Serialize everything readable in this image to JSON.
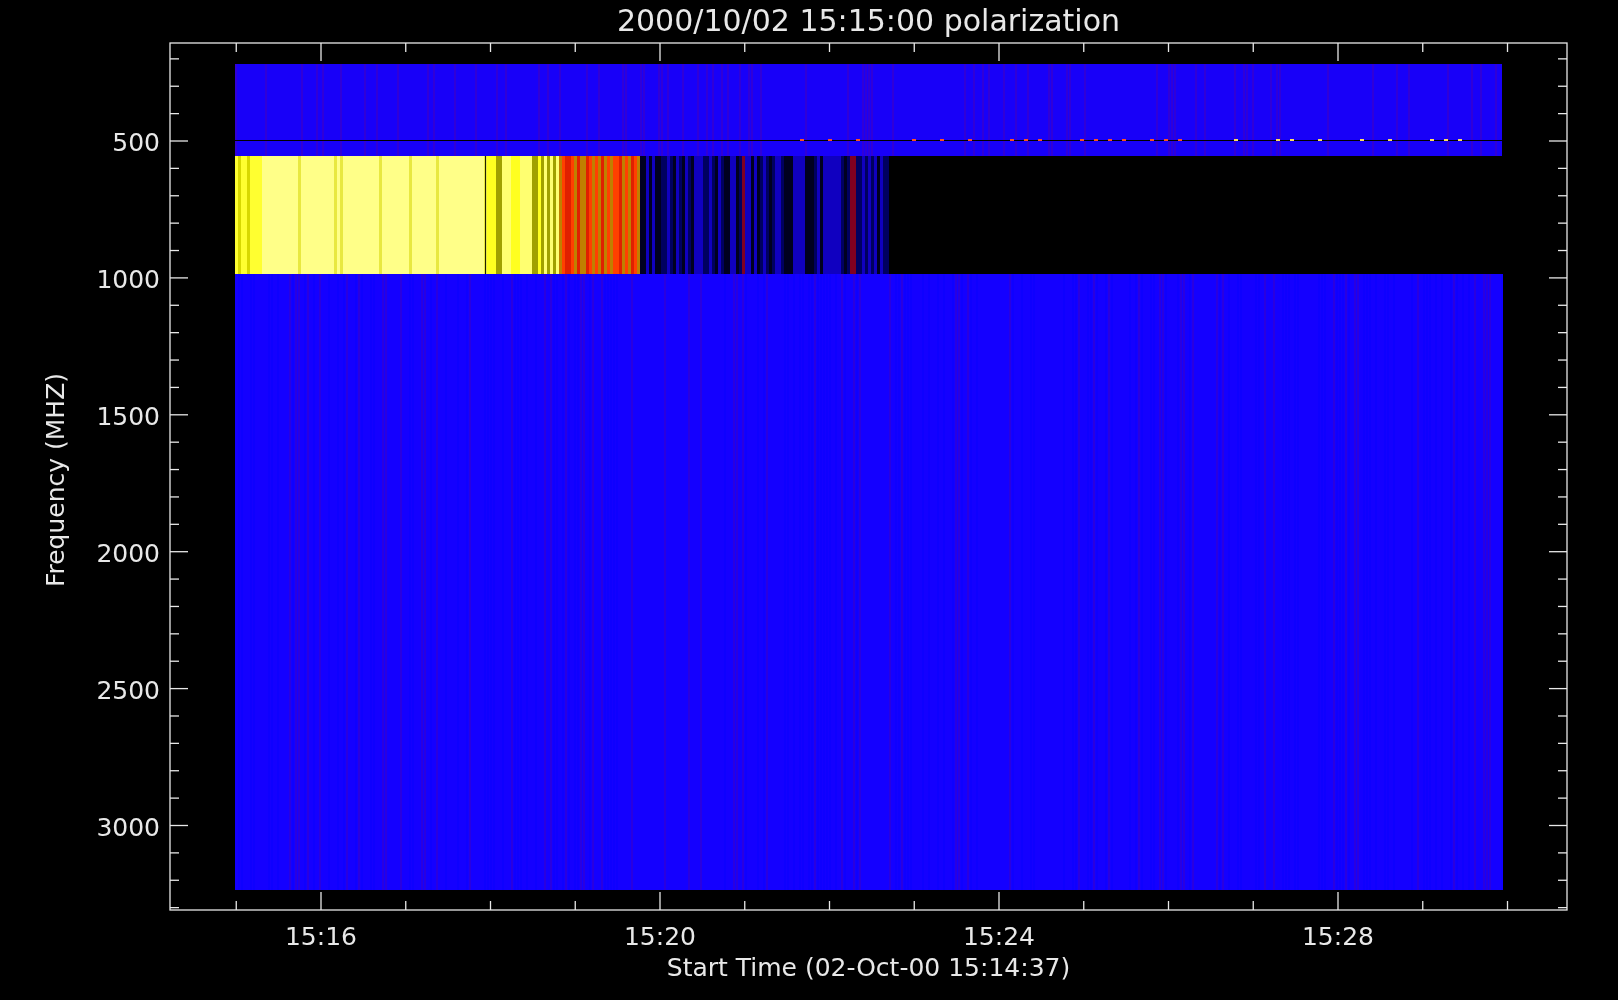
{
  "plot": {
    "title": "2000/10/02 15:15:00 polarization",
    "xlabel": "Start Time (02-Oct-00 15:14:37)",
    "ylabel": "Frequency (MHZ)",
    "xticks": [
      "15:16",
      "15:20",
      "15:24",
      "15:28"
    ],
    "yticks": [
      "500",
      "1000",
      "1500",
      "2000",
      "2500",
      "3000"
    ]
  }
}
